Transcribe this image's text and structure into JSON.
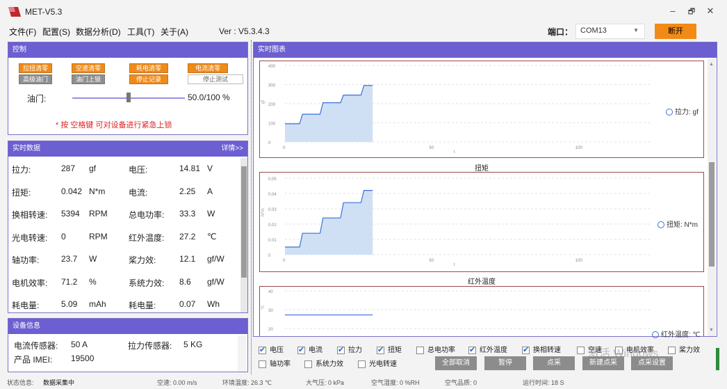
{
  "app": {
    "title": "MET-V5.3",
    "version": "Ver : V5.3.4.3"
  },
  "menu": [
    "文件(F)",
    "配置(S)",
    "数据分析(D)",
    "工具(T)",
    "关于(A)"
  ],
  "port": {
    "label": "端口：",
    "value": "COM13",
    "disconnect": "断开"
  },
  "control": {
    "title": "控制",
    "buttons_row1": [
      "拉扭清零",
      "空速清零",
      "耗电清零",
      "电流清零"
    ],
    "buttons_row2": [
      "高级油门",
      "油门上锁",
      "停止记录",
      "停止测试"
    ],
    "throttle_label": "油门:",
    "throttle_value": "50.0/100 %",
    "throttle_fraction": 0.5,
    "warning": "* 按 空格键 可对设备进行紧急上锁"
  },
  "realtime": {
    "title": "实时数据",
    "detail": "详情>>",
    "rows": [
      {
        "l1": "拉力:",
        "v1": "287",
        "u1": "gf",
        "l2": "电压:",
        "v2": "14.81",
        "u2": "V"
      },
      {
        "l1": "扭矩:",
        "v1": "0.042",
        "u1": "N*m",
        "l2": "电流:",
        "v2": "2.25",
        "u2": "A"
      },
      {
        "l1": "换相转速:",
        "v1": "5394",
        "u1": "RPM",
        "l2": "总电功率:",
        "v2": "33.3",
        "u2": "W"
      },
      {
        "l1": "光电转速:",
        "v1": "0",
        "u1": "RPM",
        "l2": "红外温度:",
        "v2": "27.2",
        "u2": "℃"
      },
      {
        "l1": "轴功率:",
        "v1": "23.7",
        "u1": "W",
        "l2": "桨力效:",
        "v2": "12.1",
        "u2": "gf/W"
      },
      {
        "l1": "电机效率:",
        "v1": "71.2",
        "u1": "%",
        "l2": "系统力效:",
        "v2": "8.6",
        "u2": "gf/W"
      },
      {
        "l1": "耗电量:",
        "v1": "5.09",
        "u1": "mAh",
        "l2": "耗电量:",
        "v2": "0.07",
        "u2": "Wh"
      }
    ]
  },
  "device": {
    "title": "设备信息",
    "current_sensor_label": "电流传感器:",
    "current_sensor_value": "50 A",
    "force_sensor_label": "拉力传感器:",
    "force_sensor_value": "5 KG",
    "imei_label": "产品 IMEI:",
    "imei_value": "19500"
  },
  "charts_panel_title": "实时图表",
  "chart_data": [
    {
      "type": "area",
      "title": "",
      "legend": "拉力: gf",
      "ylabel": "gf",
      "yticks": [
        "400",
        "300",
        "200",
        "100",
        "0"
      ],
      "xticks": [
        "0",
        "50",
        "100"
      ],
      "xlabel": "t",
      "x": [
        0,
        1,
        2,
        3,
        4,
        5,
        6,
        7,
        8,
        9,
        10,
        11,
        12,
        13,
        14,
        15,
        16,
        17,
        18,
        19,
        20,
        21,
        22,
        23,
        24,
        25,
        26,
        27,
        28,
        29,
        30
      ],
      "y": [
        95,
        95,
        95,
        95,
        95,
        95,
        145,
        145,
        145,
        145,
        145,
        145,
        145,
        205,
        205,
        205,
        205,
        205,
        205,
        205,
        245,
        245,
        245,
        245,
        245,
        245,
        245,
        295,
        295,
        295,
        295
      ]
    },
    {
      "type": "area",
      "title": "扭矩",
      "legend": "扭矩: N*m",
      "ylabel": "N*m",
      "yticks": [
        "0.05",
        "0.04",
        "0.03",
        "0.02",
        "0.01",
        "0"
      ],
      "xticks": [
        "0",
        "50",
        "100"
      ],
      "xlabel": "t",
      "x": [
        0,
        1,
        2,
        3,
        4,
        5,
        6,
        7,
        8,
        9,
        10,
        11,
        12,
        13,
        14,
        15,
        16,
        17,
        18,
        19,
        20,
        21,
        22,
        23,
        24,
        25,
        26,
        27,
        28,
        29,
        30
      ],
      "y": [
        0.005,
        0.005,
        0.005,
        0.005,
        0.005,
        0.005,
        0.014,
        0.014,
        0.014,
        0.014,
        0.014,
        0.014,
        0.014,
        0.024,
        0.024,
        0.024,
        0.024,
        0.024,
        0.024,
        0.024,
        0.034,
        0.034,
        0.034,
        0.034,
        0.034,
        0.034,
        0.034,
        0.042,
        0.042,
        0.042,
        0.042
      ]
    },
    {
      "type": "line",
      "title": "红外温度",
      "legend": "红外温度: ℃",
      "ylabel": "℃",
      "yticks": [
        "40",
        "30",
        "20"
      ],
      "x": [
        0,
        30
      ],
      "y": [
        27.2,
        27.2
      ]
    }
  ],
  "checks": [
    {
      "label": "电压",
      "checked": true
    },
    {
      "label": "电流",
      "checked": true
    },
    {
      "label": "拉力",
      "checked": true
    },
    {
      "label": "扭矩",
      "checked": true
    },
    {
      "label": "总电功率",
      "checked": false
    },
    {
      "label": "红外温度",
      "checked": true
    },
    {
      "label": "换相转速",
      "checked": true
    },
    {
      "label": "空速",
      "checked": false
    },
    {
      "label": "电机效率",
      "checked": false
    },
    {
      "label": "桨力效",
      "checked": false
    },
    {
      "label": "轴功率",
      "checked": false
    },
    {
      "label": "系统力效",
      "checked": false
    },
    {
      "label": "光电转速",
      "checked": false
    }
  ],
  "action_buttons": [
    "全部取消",
    "暂停",
    "点采",
    "新建点采",
    "点采设置"
  ],
  "watermark": "激活 Windows",
  "status": {
    "state_label": "状态信息:",
    "state_value": "数据采集中",
    "airspeed": "空速:  0.00 m/s",
    "env_temp": "环境温度:  26.3 ℃",
    "pressure": "大气压:  0 kPa",
    "humidity": "空气湿度:  0 %RH",
    "air_quality": "空气品质:  0",
    "runtime": "运行时间:  18 S"
  },
  "colors": {
    "accent": "#6c5fd1",
    "orange": "#ee8b1b",
    "chart_line": "#3a6fd8",
    "chart_fill": "#cfe0f5"
  }
}
